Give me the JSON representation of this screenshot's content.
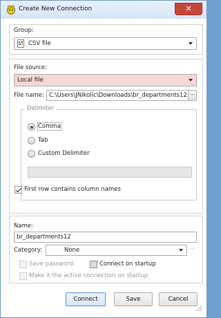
{
  "window": {
    "title": "Create New Connection",
    "close_symbol": "✕"
  },
  "group": {
    "label": "Group:",
    "value": "CSV file"
  },
  "file_source": {
    "label": "File source:",
    "value": "Local file"
  },
  "file_name": {
    "label": "File name:",
    "value": "C:\\Users\\JNikolic\\Downloads\\br_departments12.csv",
    "browse": "···"
  },
  "delimiter": {
    "legend": "Delimiter",
    "options": [
      {
        "label": "Comma",
        "selected": true
      },
      {
        "label": "Tab",
        "selected": false
      },
      {
        "label": "Custom Delimiter",
        "selected": false
      }
    ],
    "custom_value": ""
  },
  "first_row": {
    "label": "First row contains column names",
    "checked": true
  },
  "name": {
    "label": "Name:",
    "value": "br_departments12"
  },
  "category": {
    "label": "Category:",
    "value": "None",
    "ellipsis": "···"
  },
  "save_password": {
    "label": "Save password",
    "checked": false,
    "enabled": false
  },
  "connect_on_startup": {
    "label": "Connect on startup",
    "checked": false,
    "enabled": true
  },
  "make_active": {
    "label": "Make it the active connection on startup",
    "checked": false,
    "enabled": false
  },
  "buttons": {
    "connect": "Connect",
    "save": "Save",
    "cancel": "Cancel"
  },
  "colors": {
    "file_source_bg": "#f5d7d7",
    "disabled_text": "#9a9a9a",
    "title_bg": "#d4e4f5"
  }
}
